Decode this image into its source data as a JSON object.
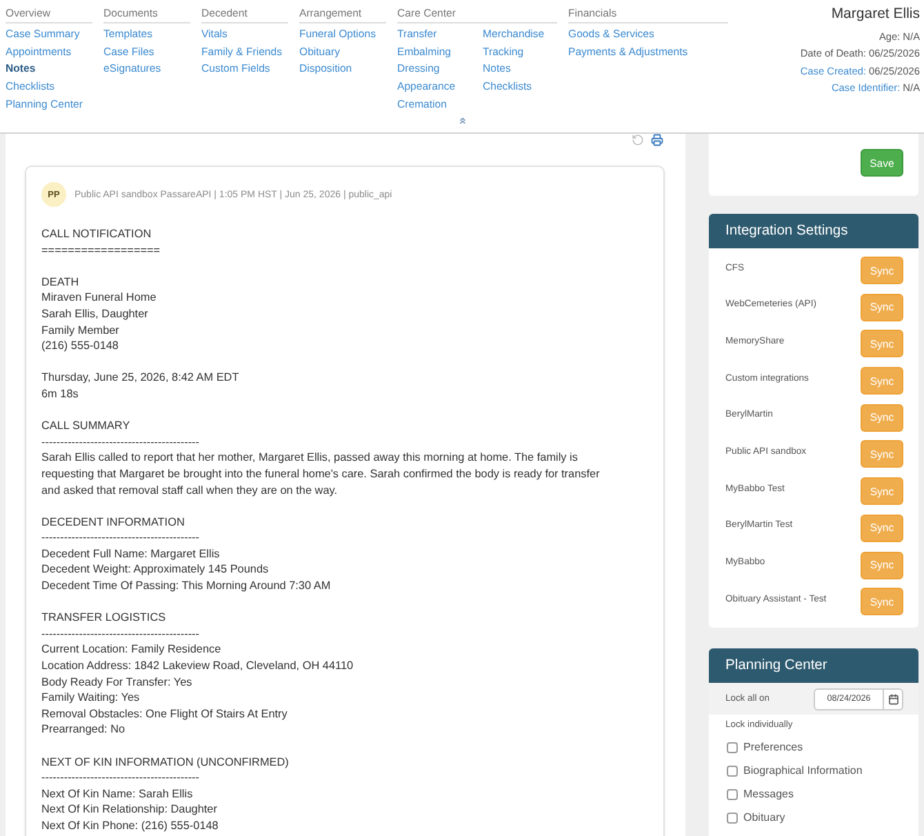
{
  "nav": [
    {
      "heading": "Overview",
      "links": [
        {
          "label": "Case Summary",
          "selected": false
        },
        {
          "label": "Appointments",
          "selected": false
        },
        {
          "label": "Notes",
          "selected": true
        },
        {
          "label": "Checklists",
          "selected": false
        },
        {
          "label": "Planning Center",
          "selected": false
        }
      ]
    },
    {
      "heading": "Documents",
      "links": [
        {
          "label": "Templates",
          "selected": false
        },
        {
          "label": "Case Files",
          "selected": false
        },
        {
          "label": "eSignatures",
          "selected": false
        }
      ]
    },
    {
      "heading": "Decedent",
      "links": [
        {
          "label": "Vitals",
          "selected": false
        },
        {
          "label": "Family & Friends",
          "selected": false
        },
        {
          "label": "Custom Fields",
          "selected": false
        }
      ]
    },
    {
      "heading": "Arrangement",
      "links": [
        {
          "label": "Funeral Options",
          "selected": false
        },
        {
          "label": "Obituary",
          "selected": false
        },
        {
          "label": "Disposition",
          "selected": false
        }
      ]
    },
    {
      "heading": "Care Center",
      "links": [
        {
          "label": "Transfer",
          "selected": false
        },
        {
          "label": "Embalming",
          "selected": false
        },
        {
          "label": "Dressing",
          "selected": false
        },
        {
          "label": "Appearance",
          "selected": false
        },
        {
          "label": "Cremation",
          "selected": false
        },
        {
          "label": "Merchandise",
          "selected": false
        },
        {
          "label": "Tracking",
          "selected": false
        },
        {
          "label": "Notes",
          "selected": false
        },
        {
          "label": "Checklists",
          "selected": false
        }
      ]
    },
    {
      "heading": "Financials",
      "links": [
        {
          "label": "Goods & Services",
          "selected": false
        },
        {
          "label": "Payments & Adjustments",
          "selected": false
        }
      ]
    }
  ],
  "case_info": {
    "name": "Margaret Ellis",
    "fields": [
      {
        "label": "Age:",
        "value": "N/A",
        "kind": "plain"
      },
      {
        "label": "Date of Death:",
        "value": "06/25/2026",
        "kind": "plain"
      },
      {
        "label": "Case Created:",
        "value": "06/25/2026",
        "kind": "link"
      },
      {
        "label": "Case Identifier:",
        "value": "N/A",
        "kind": "link"
      }
    ]
  },
  "note": {
    "initials": "PP",
    "meta": "Public API sandbox PassareAPI | 1:05 PM HST | Jun 25, 2026 | public_api",
    "blocks": [
      [
        "CALL NOTIFICATION",
        "=================="
      ],
      [
        "DEATH",
        "Miraven Funeral Home",
        "Sarah Ellis, Daughter",
        "Family Member",
        "(216) 555-0148"
      ],
      [
        "Thursday, June 25, 2026, 8:42 AM EDT",
        "6m 18s"
      ],
      [
        "CALL SUMMARY",
        "------------------------------------------",
        "Sarah Ellis called to report that her mother, Margaret Ellis, passed away this morning at home. The family is requesting that Margaret be brought into the funeral home's care. Sarah confirmed the body is ready for transfer and asked that removal staff call when they are on the way."
      ],
      [
        "DECEDENT INFORMATION",
        "------------------------------------------",
        "Decedent Full Name: Margaret Ellis",
        "Decedent Weight: Approximately 145 Pounds",
        "Decedent Time Of Passing: This Morning Around 7:30 AM"
      ],
      [
        "TRANSFER LOGISTICS",
        "------------------------------------------",
        "Current Location: Family Residence",
        "Location Address: 1842 Lakeview Road, Cleveland, OH 44110",
        "Body Ready For Transfer: Yes",
        "Family Waiting: Yes",
        "Removal Obstacles: One Flight Of Stairs At Entry",
        "Prearranged: No"
      ],
      [
        "NEXT OF KIN INFORMATION (UNCONFIRMED)",
        "------------------------------------------",
        "Next Of Kin Name: Sarah Ellis",
        "Next Of Kin Relationship: Daughter",
        "Next Of Kin Phone: (216) 555-0148"
      ]
    ]
  },
  "form_card": {
    "save_button": "Save"
  },
  "integration_settings": {
    "title": "Integration Settings",
    "items": [
      {
        "name": "CFS",
        "button": "Sync"
      },
      {
        "name": "WebCemeteries (API)",
        "button": "Sync"
      },
      {
        "name": "MemoryShare",
        "button": "Sync"
      },
      {
        "name": "Custom integrations",
        "button": "Sync"
      },
      {
        "name": "BerylMartin",
        "button": "Sync"
      },
      {
        "name": "Public API sandbox",
        "button": "Sync"
      },
      {
        "name": "MyBabbo Test",
        "button": "Sync"
      },
      {
        "name": "BerylMartin Test",
        "button": "Sync"
      },
      {
        "name": "MyBabbo",
        "button": "Sync"
      },
      {
        "name": "Obituary Assistant - Test",
        "button": "Sync"
      }
    ]
  },
  "planning_center": {
    "title": "Planning Center",
    "lock_all_label": "Lock all on",
    "lock_date": "08/24/2026",
    "lock_individually_label": "Lock individually",
    "items": [
      {
        "label": "Preferences",
        "checked": false
      },
      {
        "label": "Biographical Information",
        "checked": false
      },
      {
        "label": "Messages",
        "checked": false
      },
      {
        "label": "Obituary",
        "checked": false
      }
    ]
  }
}
